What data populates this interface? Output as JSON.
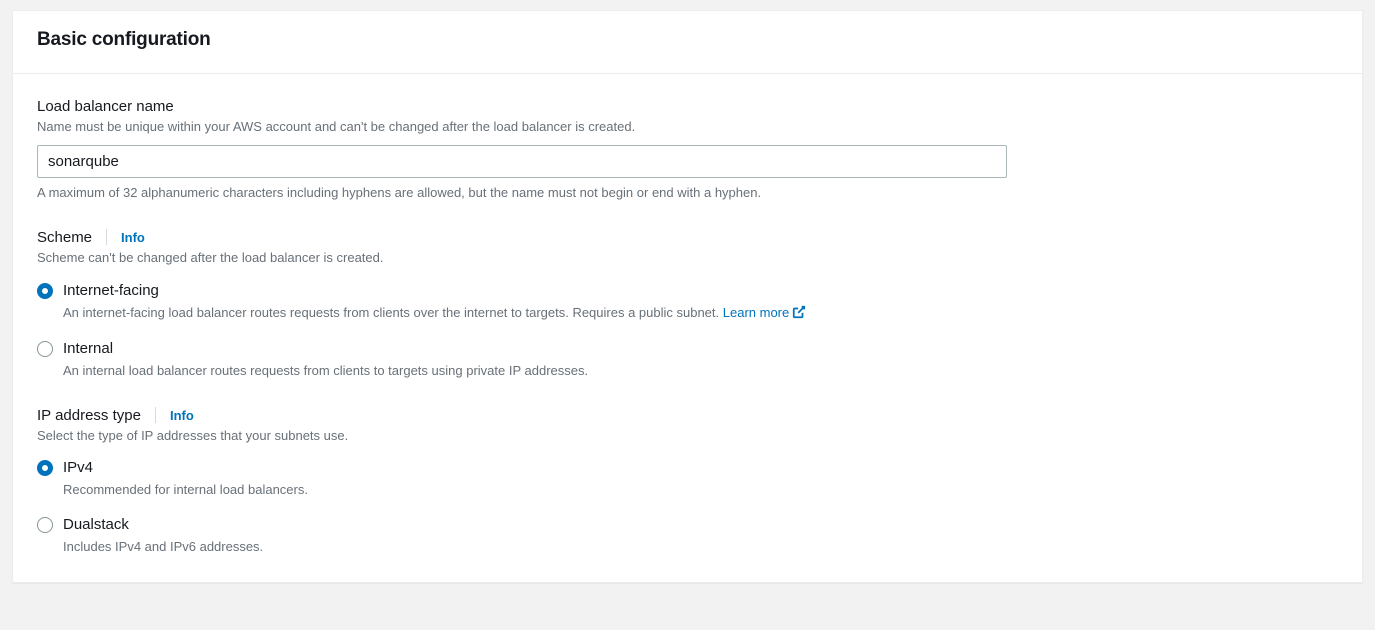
{
  "panel": {
    "title": "Basic configuration"
  },
  "name_field": {
    "label": "Load balancer name",
    "helper": "Name must be unique within your AWS account and can't be changed after the load balancer is created.",
    "value": "sonarqube",
    "constraint": "A maximum of 32 alphanumeric characters including hyphens are allowed, but the name must not begin or end with a hyphen."
  },
  "scheme_field": {
    "label": "Scheme",
    "info": "Info",
    "helper": "Scheme can't be changed after the load balancer is created.",
    "options": [
      {
        "label": "Internet-facing",
        "desc_prefix": "An internet-facing load balancer routes requests from clients over the internet to targets. Requires a public subnet. ",
        "learn_more": "Learn more",
        "checked": true
      },
      {
        "label": "Internal",
        "desc": "An internal load balancer routes requests from clients to targets using private IP addresses.",
        "checked": false
      }
    ]
  },
  "ip_field": {
    "label": "IP address type",
    "info": "Info",
    "helper": "Select the type of IP addresses that your subnets use.",
    "options": [
      {
        "label": "IPv4",
        "desc": "Recommended for internal load balancers.",
        "checked": true
      },
      {
        "label": "Dualstack",
        "desc": "Includes IPv4 and IPv6 addresses.",
        "checked": false
      }
    ]
  }
}
